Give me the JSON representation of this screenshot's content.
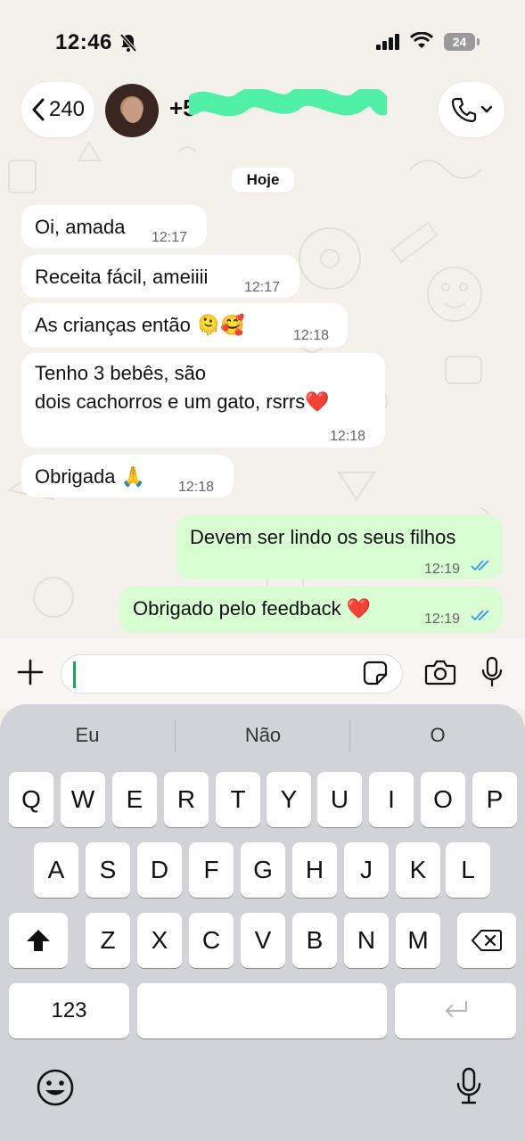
{
  "status_bar": {
    "time": "12:46",
    "battery": "24"
  },
  "header": {
    "back_count": "240",
    "contact_name": "+5"
  },
  "date_chip": "Hoje",
  "messages": [
    {
      "dir": "in",
      "text": "Oi, amada",
      "time": "12:17"
    },
    {
      "dir": "in",
      "text": "Receita fácil, ameiiii",
      "time": "12:17"
    },
    {
      "dir": "in",
      "text": "As crianças então 🫠🥰",
      "time": "12:18"
    },
    {
      "dir": "in",
      "text_line1": "Tenho 3 bebês, são",
      "text_line2": "dois cachorros e um gato, rsrrs❤️",
      "time": "12:18"
    },
    {
      "dir": "in",
      "text": "Obrigada 🙏",
      "time": "12:18"
    },
    {
      "dir": "out",
      "text": "Devem ser lindo os seus filhos",
      "time": "12:19"
    },
    {
      "dir": "out",
      "text": "Obrigado pelo feedback ❤️",
      "time": "12:19"
    }
  ],
  "keyboard": {
    "suggestions": [
      "Eu",
      "Não",
      "O"
    ],
    "row1": [
      "Q",
      "W",
      "E",
      "R",
      "T",
      "Y",
      "U",
      "I",
      "O",
      "P"
    ],
    "row2": [
      "A",
      "S",
      "D",
      "F",
      "G",
      "H",
      "J",
      "K",
      "L"
    ],
    "row3": [
      "Z",
      "X",
      "C",
      "V",
      "B",
      "N",
      "M"
    ],
    "numbers_key": "123"
  },
  "colors": {
    "outgoing_bubble": "#d9fdd3",
    "incoming_bubble": "#ffffff",
    "read_ticks": "#3497f9",
    "accent": "#1da15b"
  }
}
